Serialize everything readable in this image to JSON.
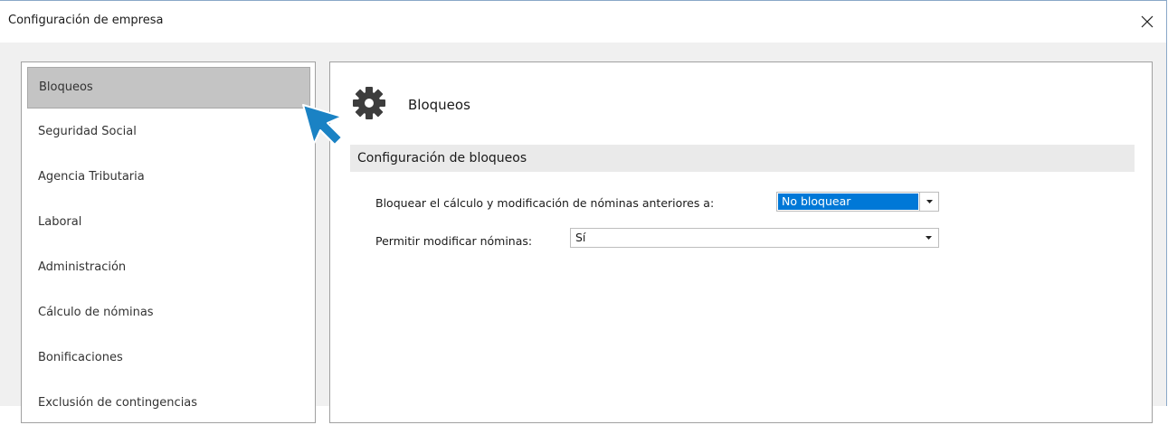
{
  "window": {
    "title": "Configuración de empresa"
  },
  "sidebar": {
    "items": [
      {
        "label": "Bloqueos",
        "selected": true
      },
      {
        "label": "Seguridad Social",
        "selected": false
      },
      {
        "label": "Agencia Tributaria",
        "selected": false
      },
      {
        "label": "Laboral",
        "selected": false
      },
      {
        "label": "Administración",
        "selected": false
      },
      {
        "label": "Cálculo de nóminas",
        "selected": false
      },
      {
        "label": "Bonificaciones",
        "selected": false
      },
      {
        "label": "Exclusión de contingencias",
        "selected": false
      }
    ]
  },
  "main": {
    "heading": "Bloqueos",
    "heading_icon": "gear-icon",
    "group_title": "Configuración de bloqueos",
    "fields": {
      "bloquear": {
        "label": "Bloquear el cálculo y modificación de nóminas anteriores a:",
        "value": "No bloquear"
      },
      "permitir": {
        "label": "Permitir modificar nóminas:",
        "value": "Sí"
      }
    }
  },
  "colors": {
    "selection": "#0078d7",
    "pointer": "#1a82c4",
    "selected_item": "#c4c4c4"
  }
}
